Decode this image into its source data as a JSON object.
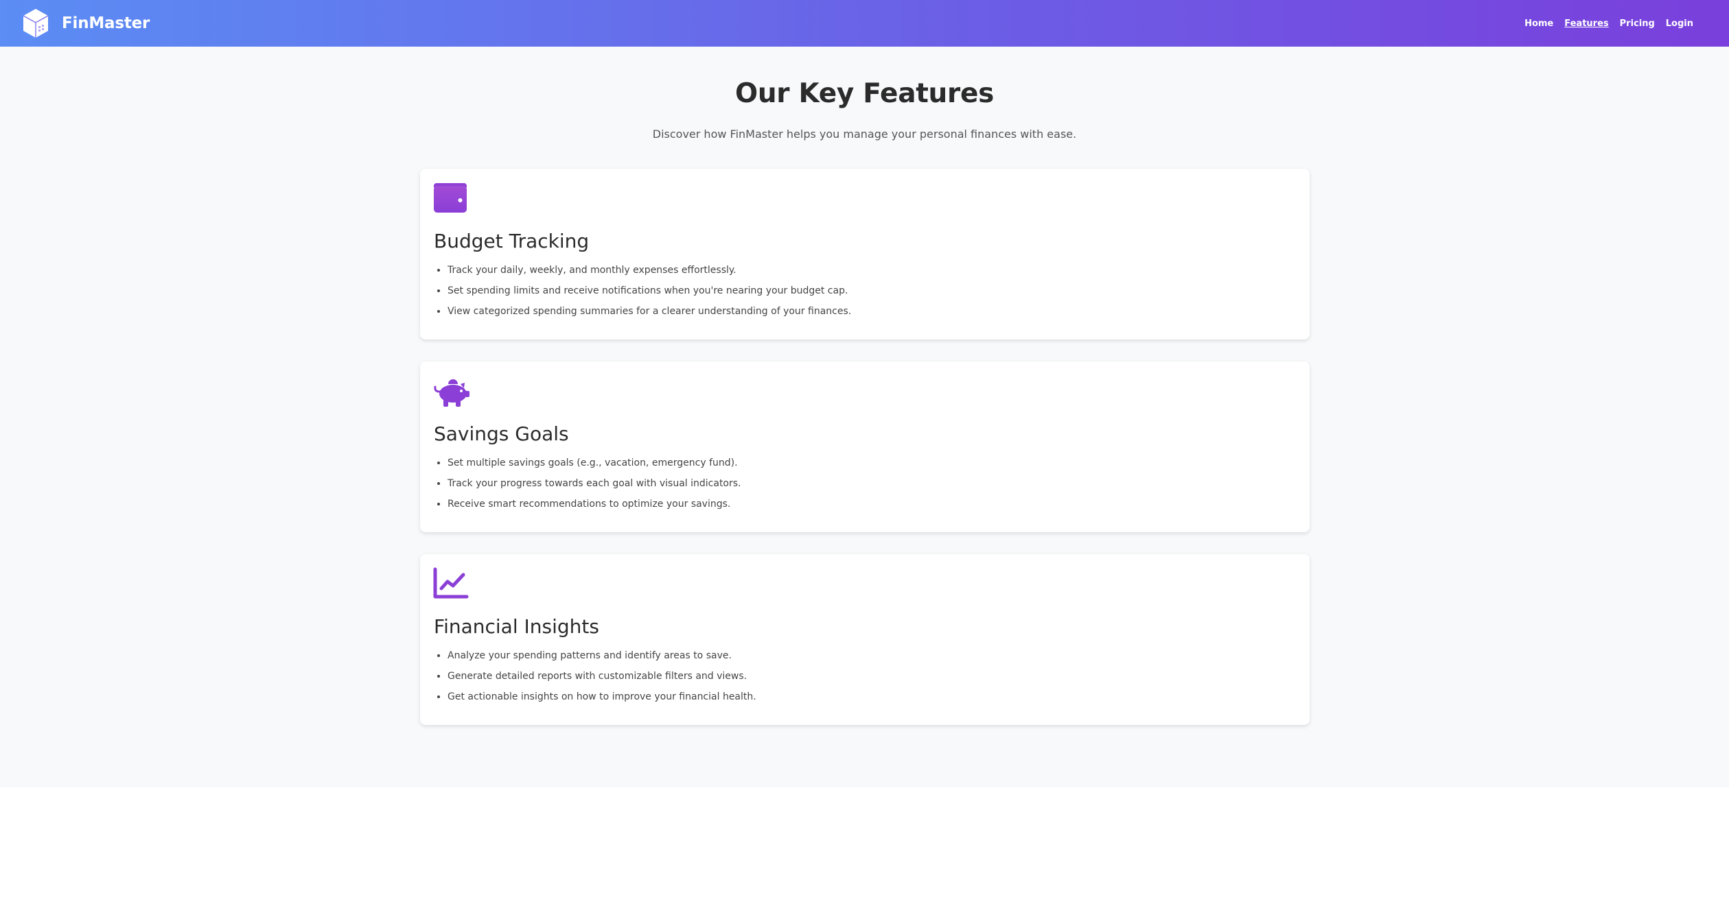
{
  "brand": {
    "name": "FinMaster",
    "icon": "cube-icon"
  },
  "nav": {
    "items": [
      {
        "label": "Home",
        "active": false
      },
      {
        "label": "Features",
        "active": true
      },
      {
        "label": "Pricing",
        "active": false
      },
      {
        "label": "Login",
        "active": false
      }
    ]
  },
  "main": {
    "title": "Our Key Features",
    "subtitle": "Discover how FinMaster helps you manage your personal finances with ease."
  },
  "features": [
    {
      "icon": "wallet-icon",
      "title": "Budget Tracking",
      "items": [
        "Track your daily, weekly, and monthly expenses effortlessly.",
        "Set spending limits and receive notifications when you're nearing your budget cap.",
        "View categorized spending summaries for a clearer understanding of your finances."
      ]
    },
    {
      "icon": "piggy-bank-icon",
      "title": "Savings Goals",
      "items": [
        "Set multiple savings goals (e.g., vacation, emergency fund).",
        "Track your progress towards each goal with visual indicators.",
        "Receive smart recommendations to optimize your savings."
      ]
    },
    {
      "icon": "chart-line-icon",
      "title": "Financial Insights",
      "items": [
        "Analyze your spending patterns and identify areas to save.",
        "Generate detailed reports with customizable filters and views.",
        "Get actionable insights on how to improve your financial health."
      ]
    }
  ],
  "colors": {
    "nav_gradient_start": "#5b8df4",
    "nav_gradient_end": "#7a3fdc",
    "icon_accent": "#8b3fd6",
    "background": "#f8f9fa",
    "card": "#ffffff"
  }
}
